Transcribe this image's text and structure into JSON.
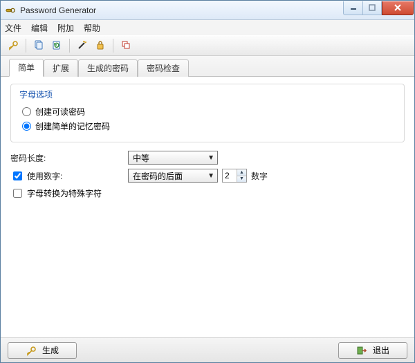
{
  "window": {
    "title": "Password Generator"
  },
  "menu": {
    "file": "文件",
    "edit": "编辑",
    "extra": "附加",
    "help": "帮助"
  },
  "toolbar_icons": {
    "key": "key-icon",
    "copy": "copy-icon",
    "refresh": "refresh-icon",
    "wand": "wand-icon",
    "lock": "lock-icon",
    "stack": "stack-icon"
  },
  "tabs": {
    "simple": "简单",
    "extended": "扩展",
    "generated": "生成的密码",
    "check": "密码检查",
    "active": "simple"
  },
  "group": {
    "legend": "字母选项",
    "radio_readable": "创建可读密码",
    "radio_memorable": "创建简单的记忆密码",
    "selected": "memorable"
  },
  "length": {
    "label": "密码长度:",
    "value": "中等"
  },
  "digits": {
    "use_label": "使用数字:",
    "use_checked": true,
    "position": "在密码的后面",
    "count": "2",
    "tail": "数字"
  },
  "special": {
    "label": "字母转换为特殊字符",
    "checked": false
  },
  "footer": {
    "generate": "生成",
    "exit": "退出"
  }
}
